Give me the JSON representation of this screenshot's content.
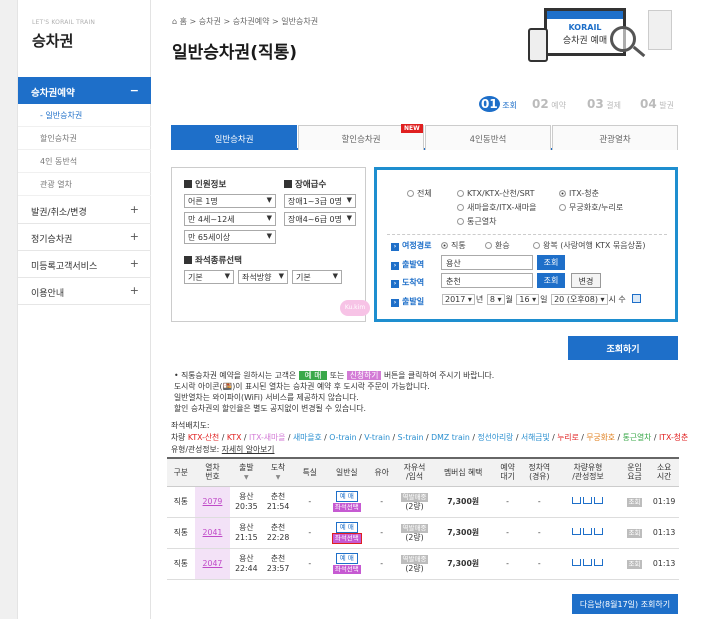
{
  "sidebar": {
    "small_label": "LET'S KORAIL TRAIN",
    "title": "승차권",
    "active": "승차권예약",
    "active_pm": "−",
    "subs": [
      "일반승차권",
      "할인승차권",
      "4인 동반석",
      "관광 열차"
    ],
    "mains": [
      "발권/취소/변경",
      "정기승차권",
      "미등록고객서비스",
      "이용안내"
    ],
    "plus": "+"
  },
  "breadcrumb": {
    "home": "홈",
    "items": [
      "승차권",
      "승차권예약",
      "일반승차권"
    ],
    "sep": ">"
  },
  "page_title": "일반승차권(직통)",
  "banner": {
    "logo": "KORAIL",
    "text": "승차권 예매"
  },
  "steps": [
    {
      "num": "01",
      "label": "조회"
    },
    {
      "num": "02",
      "label": "예약"
    },
    {
      "num": "03",
      "label": "결제"
    },
    {
      "num": "04",
      "label": "발권"
    }
  ],
  "tabs": [
    "일반승차권",
    "할인승차권",
    "4인동반석",
    "관광열차"
  ],
  "new_badge": "NEW",
  "options": {
    "people_title": "인원정보",
    "people": [
      "어른 1명",
      "만 4세~12세",
      "만 65세이상"
    ],
    "disabled_title": "장애급수",
    "disabled": [
      "장애1~3급 0명",
      "장애4~6급 0명"
    ],
    "seat_title": "좌석종류선택",
    "seat": [
      "기본",
      "좌석방향",
      "기본"
    ]
  },
  "search": {
    "types": [
      "전체",
      "KTX/KTX-산천/SRT",
      "ITX-청춘",
      "새마을호/ITX-새마을",
      "무궁화호/누리로",
      "통근열차"
    ],
    "route_label": "여정경로",
    "routes": [
      "직통",
      "환승",
      "왕복 (사랑여행 KTX 묶음상품)"
    ],
    "dep_label": "출발역",
    "dep_value": "용산",
    "arr_label": "도착역",
    "arr_value": "춘천",
    "query_btn": "조회",
    "swap_btn": "변경",
    "date_label": "출발일",
    "year": "2017",
    "y_unit": "년",
    "month": "8",
    "m_unit": "월",
    "day": "16",
    "d_unit": "일",
    "time": "20 (오후08)",
    "t_unit": "시 수"
  },
  "search_button": "조회하기",
  "watermark": "Ku.kim",
  "notes": {
    "l1a": "직통승차권 예약을 원하시는 고객은",
    "l1_tag1": "예 매",
    "l1b": "또는",
    "l1_tag2": "신청하기",
    "l1c": "버튼을 클릭하여 주시기 바랍니다.",
    "l2": "도시락 아이콘(🍱)이 표시된 열차는 승차권 예약 후 도시락 주문이 가능합니다.",
    "l3": "일반열차는 와이파이(WiFi) 서비스를 제공하지 않습니다.",
    "l4": "할인 승차권의 할인율은 별도 공지없이 변경될 수 있습니다."
  },
  "legend": {
    "seat_label": "좌석배치도:",
    "car_label": "차량",
    "car_types": [
      {
        "name": "KTX-산천",
        "color": "#e02020"
      },
      {
        "name": "KTX",
        "color": "#e02020"
      },
      {
        "name": "ITX-새마을",
        "color": "#d37bd6"
      },
      {
        "name": "새마을호",
        "color": "#2a8fd0"
      },
      {
        "name": "O-train",
        "color": "#2a8fd0"
      },
      {
        "name": "V-train",
        "color": "#2a8fd0"
      },
      {
        "name": "S-train",
        "color": "#2a8fd0"
      },
      {
        "name": "DMZ train",
        "color": "#2a8fd0"
      },
      {
        "name": "정선아리랑",
        "color": "#2a8fd0"
      },
      {
        "name": "서해금빛",
        "color": "#2a8fd0"
      },
      {
        "name": "누리로",
        "color": "#e02020"
      },
      {
        "name": "무궁화호",
        "color": "#e08020"
      },
      {
        "name": "통근열차",
        "color": "#3aa84a"
      },
      {
        "name": "ITX-청춘",
        "color": "#e02020"
      }
    ],
    "type_label": "유형/관성정보:",
    "type_link": "자세히 알아보기"
  },
  "table": {
    "headers": [
      "구분",
      "열차\n번호",
      "출발",
      "도착",
      "특실",
      "일반실",
      "유아",
      "자유석\n/입석",
      "멤버십 혜택",
      "예약\n대기",
      "정차역\n(경유)",
      "차량유형\n/관성정보",
      "운임\n요금",
      "소요\n시간"
    ],
    "rows": [
      {
        "kind": "직통",
        "no": "2079",
        "dep": "용산",
        "dep_t": "20:35",
        "arr": "춘천",
        "arr_t": "21:54",
        "first": "-",
        "baby": "-",
        "free": "역발매중",
        "free2": "(2량)",
        "member": "7,300원",
        "wait": "-",
        "stop": "-",
        "fare": "조회",
        "dur": "01:19"
      },
      {
        "kind": "직통",
        "no": "2041",
        "dep": "용산",
        "dep_t": "21:15",
        "arr": "춘천",
        "arr_t": "22:28",
        "first": "-",
        "baby": "-",
        "free": "역발매중",
        "free2": "(2량)",
        "member": "7,300원",
        "wait": "-",
        "stop": "-",
        "fare": "조회",
        "dur": "01:13"
      },
      {
        "kind": "직통",
        "no": "2047",
        "dep": "용산",
        "dep_t": "22:44",
        "arr": "춘천",
        "arr_t": "23:57",
        "first": "-",
        "baby": "-",
        "free": "역발매중",
        "free2": "(2량)",
        "member": "7,300원",
        "wait": "-",
        "stop": "-",
        "fare": "조회",
        "dur": "01:13"
      }
    ],
    "btn_book": "예 매",
    "btn_seat": "좌석선택"
  },
  "next_button": "다음날(8월17일) 조회하기",
  "colors": {
    "accent": "#1e6fc9",
    "search_border": "#1e8ecf",
    "seat_purple": "#c65ad2"
  }
}
